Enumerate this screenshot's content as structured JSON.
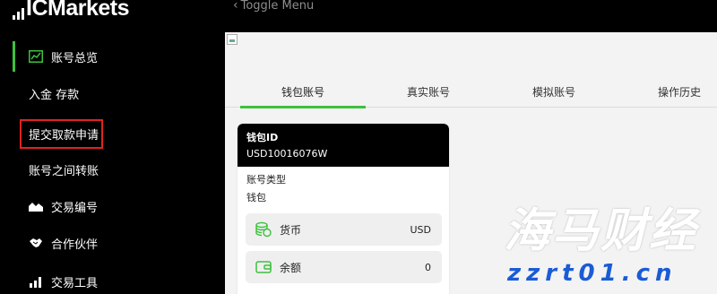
{
  "brand": {
    "logo_prefix": "IC",
    "logo_suffix": "Markets"
  },
  "toggle_menu": {
    "label": "Toggle Menu"
  },
  "sidebar": {
    "items": [
      {
        "label": "账号总览",
        "icon": "account-overview-icon",
        "active": true
      },
      {
        "label": "入金 存款"
      },
      {
        "label": "提交取款申请",
        "highlighted": true
      },
      {
        "label": "账号之间转账"
      },
      {
        "label": "交易编号",
        "icon": "chart-area-icon"
      },
      {
        "label": "合作伙伴",
        "icon": "handshake-icon"
      },
      {
        "label": "交易工具",
        "icon": "bar-chart-icon"
      }
    ]
  },
  "tabs": [
    {
      "label": "钱包账号",
      "active": true
    },
    {
      "label": "真实账号"
    },
    {
      "label": "模拟账号"
    },
    {
      "label": "操作历史"
    }
  ],
  "wallet_card": {
    "id_label": "钱包ID",
    "id_value": "USD10016076W",
    "type_label": "账号类型",
    "type_value": "钱包",
    "currency": {
      "label": "货币",
      "value": "USD",
      "icon": "coins-icon"
    },
    "balance": {
      "label": "余额",
      "value": "0",
      "icon": "wallet-icon"
    }
  },
  "watermark": {
    "chinese": "海马财经",
    "url": "zzrt01.cn"
  },
  "colors": {
    "accent_green": "#3ec13e",
    "highlight_red": "#e02222",
    "watermark_blue": "#1a5bd6"
  }
}
